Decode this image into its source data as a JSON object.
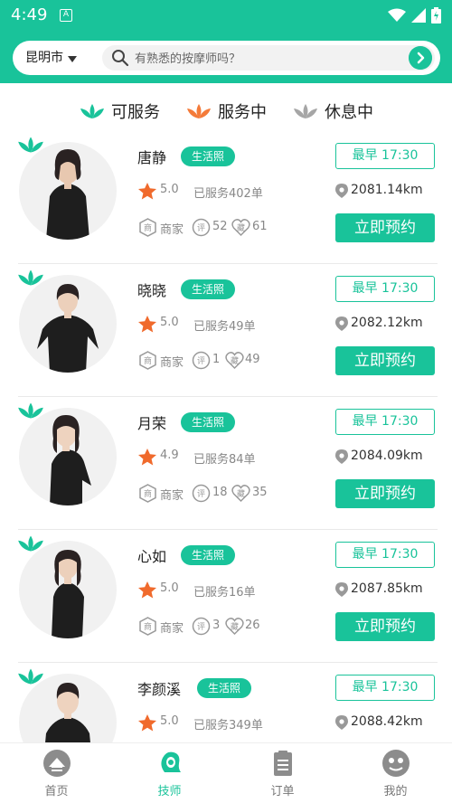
{
  "status_bar": {
    "time": "4:49",
    "notif_icon": "A"
  },
  "search": {
    "city": "昆明市",
    "placeholder": "有熟悉的按摩师吗？"
  },
  "legend": [
    {
      "label": "可服务",
      "color": "#19c39a"
    },
    {
      "label": "服务中",
      "color": "#f47b3a"
    },
    {
      "label": "休息中",
      "color": "#a6a6a6"
    }
  ],
  "life_tag": "生活照",
  "shop_label": "商家",
  "book_label": "立即预约",
  "therapists": [
    {
      "name": "唐静",
      "rating": "5.0",
      "served": "已服务402单",
      "reviews": "52",
      "favorites": "61",
      "earliest": "最早 17:30",
      "distance": "2081.14km"
    },
    {
      "name": "晓晓",
      "rating": "5.0",
      "served": "已服务49单",
      "reviews": "1",
      "favorites": "49",
      "earliest": "最早 17:30",
      "distance": "2082.12km"
    },
    {
      "name": "月荣",
      "rating": "4.9",
      "served": "已服务84单",
      "reviews": "18",
      "favorites": "35",
      "earliest": "最早 17:30",
      "distance": "2084.09km"
    },
    {
      "name": "心如",
      "rating": "5.0",
      "served": "已服务16单",
      "reviews": "3",
      "favorites": "26",
      "earliest": "最早 17:30",
      "distance": "2087.85km"
    },
    {
      "name": "李颜溪",
      "rating": "5.0",
      "served": "已服务349单",
      "reviews": "",
      "favorites": "",
      "earliest": "最早 17:30",
      "distance": "2088.42km"
    }
  ],
  "tabs": [
    {
      "label": "首页",
      "icon": "home-icon"
    },
    {
      "label": "技师",
      "icon": "technician-icon"
    },
    {
      "label": "订单",
      "icon": "order-icon"
    },
    {
      "label": "我的",
      "icon": "profile-icon"
    }
  ],
  "colors": {
    "accent": "#19c39a",
    "star": "#f06a2c",
    "inactive": "#a6a6a6"
  }
}
